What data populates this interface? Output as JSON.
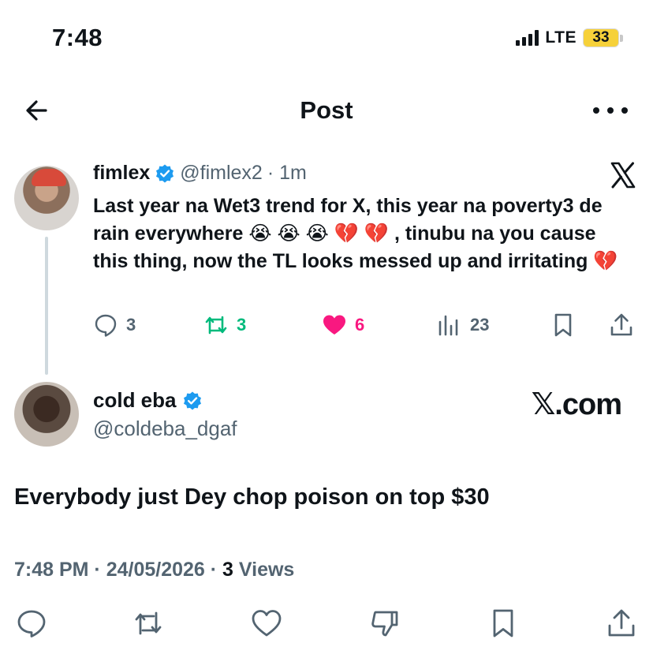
{
  "status": {
    "time": "7:48",
    "network": "LTE",
    "battery": "33"
  },
  "header": {
    "title": "Post"
  },
  "quoted": {
    "name": "fimlex",
    "handle": "@fimlex2",
    "time": "· 1m",
    "text": "Last year na Wet3 trend for X, this year na poverty3 de rain everywhere 😭 😭 😭 💔 💔 , tinubu na you cause this thing, now the TL looks messed up and irritating 💔",
    "replies": "3",
    "reposts": "3",
    "likes": "6",
    "views": "23",
    "colors": {
      "repost": "#00ba7c",
      "like": "#f91880",
      "muted": "#536471"
    }
  },
  "main": {
    "name": "cold eba",
    "handle": "@coldeba_dgaf",
    "watermark": "𝕏.com",
    "text": "Everybody just Dey chop poison on top $30",
    "timestamp": "7:48 PM · 24/05/2026 · ",
    "views_count": "3",
    "views_label": " Views"
  },
  "icons": [
    "back-arrow-icon",
    "more-icon",
    "verified-icon",
    "x-logo-icon",
    "reply-icon",
    "repost-icon",
    "like-icon",
    "views-icon",
    "bookmark-icon",
    "share-icon",
    "dislike-icon"
  ],
  "accent": "#1d9bf0"
}
